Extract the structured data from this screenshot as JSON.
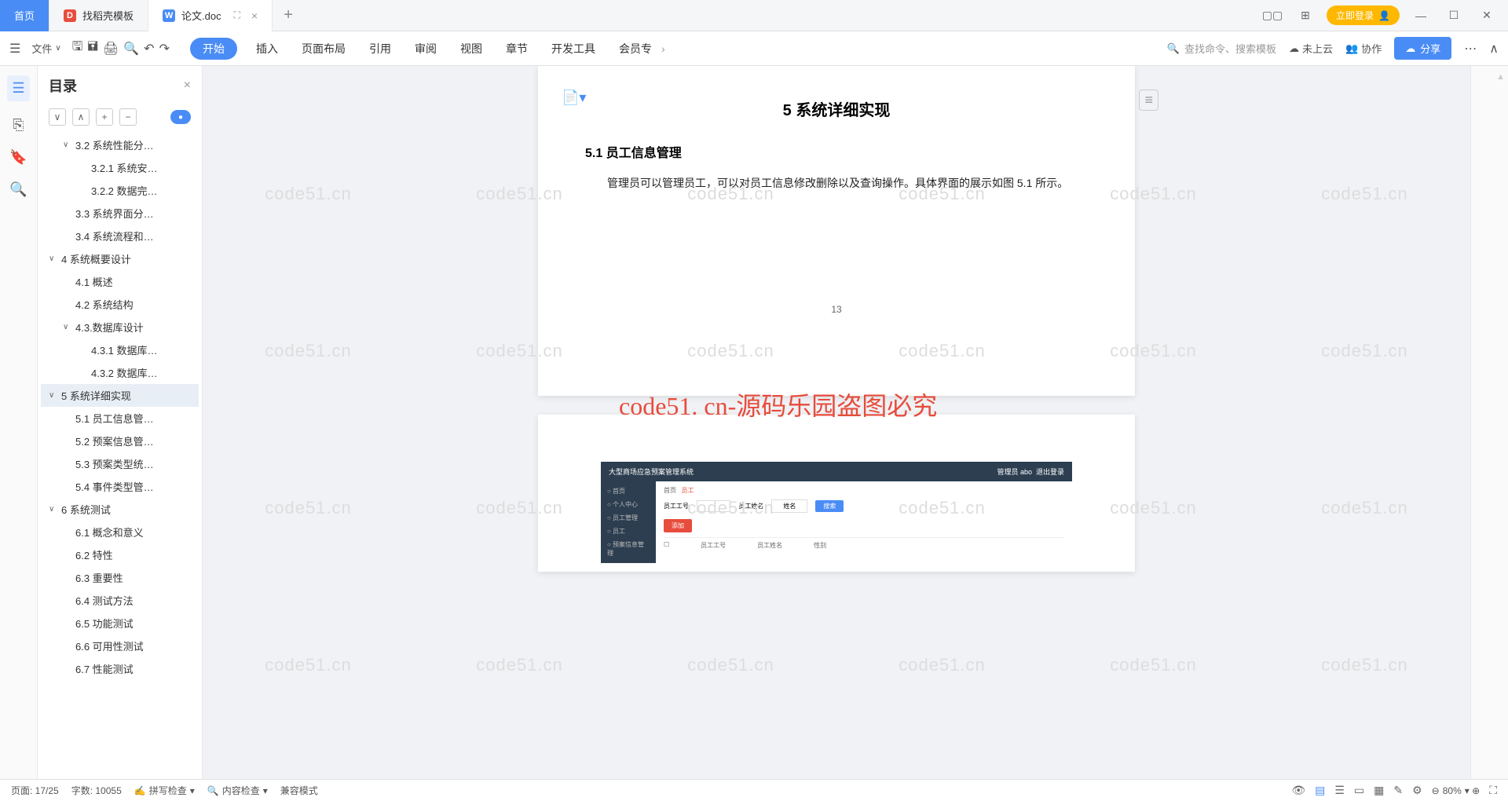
{
  "titlebar": {
    "home": "首页",
    "tab1": "找稻壳模板",
    "tab2": "论文.doc",
    "login": "立即登录"
  },
  "toolbar": {
    "file": "文件",
    "ribbon": [
      "开始",
      "插入",
      "页面布局",
      "引用",
      "审阅",
      "视图",
      "章节",
      "开发工具",
      "会员专"
    ],
    "search": "查找命令、搜索模板",
    "cloud": "未上云",
    "collab": "协作",
    "share": "分享"
  },
  "outline": {
    "title": "目录",
    "items": [
      {
        "lvl": 2,
        "chev": true,
        "t": "3.2 系统性能分…"
      },
      {
        "lvl": 3,
        "t": "3.2.1 系统安…"
      },
      {
        "lvl": 3,
        "t": "3.2.2 数据完…"
      },
      {
        "lvl": 2,
        "t": "3.3 系统界面分…"
      },
      {
        "lvl": 2,
        "t": "3.4 系统流程和…"
      },
      {
        "lvl": 1,
        "chev": true,
        "t": "4 系统概要设计"
      },
      {
        "lvl": 2,
        "t": "4.1 概述"
      },
      {
        "lvl": 2,
        "t": "4.2 系统结构"
      },
      {
        "lvl": 2,
        "chev": true,
        "t": "4.3.数据库设计"
      },
      {
        "lvl": 3,
        "t": "4.3.1 数据库…"
      },
      {
        "lvl": 3,
        "t": "4.3.2 数据库…"
      },
      {
        "lvl": 1,
        "chev": true,
        "sel": true,
        "t": "5 系统详细实现"
      },
      {
        "lvl": 2,
        "t": "5.1 员工信息管…"
      },
      {
        "lvl": 2,
        "t": "5.2 预案信息管…"
      },
      {
        "lvl": 2,
        "t": "5.3 预案类型统…"
      },
      {
        "lvl": 2,
        "t": "5.4 事件类型管…"
      },
      {
        "lvl": 1,
        "chev": true,
        "t": "6 系统测试"
      },
      {
        "lvl": 2,
        "t": "6.1 概念和意义"
      },
      {
        "lvl": 2,
        "t": "6.2 特性"
      },
      {
        "lvl": 2,
        "t": "6.3 重要性"
      },
      {
        "lvl": 2,
        "t": "6.4 测试方法"
      },
      {
        "lvl": 2,
        "t": "6.5 功能测试"
      },
      {
        "lvl": 2,
        "t": "6.6 可用性测试"
      },
      {
        "lvl": 2,
        "t": "6.7 性能测试"
      }
    ]
  },
  "doc": {
    "h1": "5 系统详细实现",
    "h2": "5.1  员工信息管理",
    "p": "管理员可以管理员工，可以对员工信息修改删除以及查询操作。具体界面的展示如图 5.1 所示。",
    "pagenum": "13",
    "wm": "code51.cn",
    "wmbig": "code51. cn-源码乐园盗图必究"
  },
  "embed": {
    "title": "大型商场应急预案管理系统",
    "user": "管理员 abo",
    "logout": "退出登录",
    "nav": [
      "首页",
      "个人中心",
      "员工管理",
      "员工",
      "预案信息管理"
    ],
    "crumb": "首页",
    "crumb2": "员工",
    "f1": "员工工号",
    "f2": "员工姓名",
    "ph": "姓名",
    "search": "搜索",
    "add": "添加",
    "th1": "员工工号",
    "th2": "员工姓名",
    "th3": "性别"
  },
  "status": {
    "page": "页面: 17/25",
    "words": "字数: 10055",
    "spell": "拼写检查",
    "content": "内容检查",
    "compat": "兼容模式",
    "zoom": "80%"
  }
}
